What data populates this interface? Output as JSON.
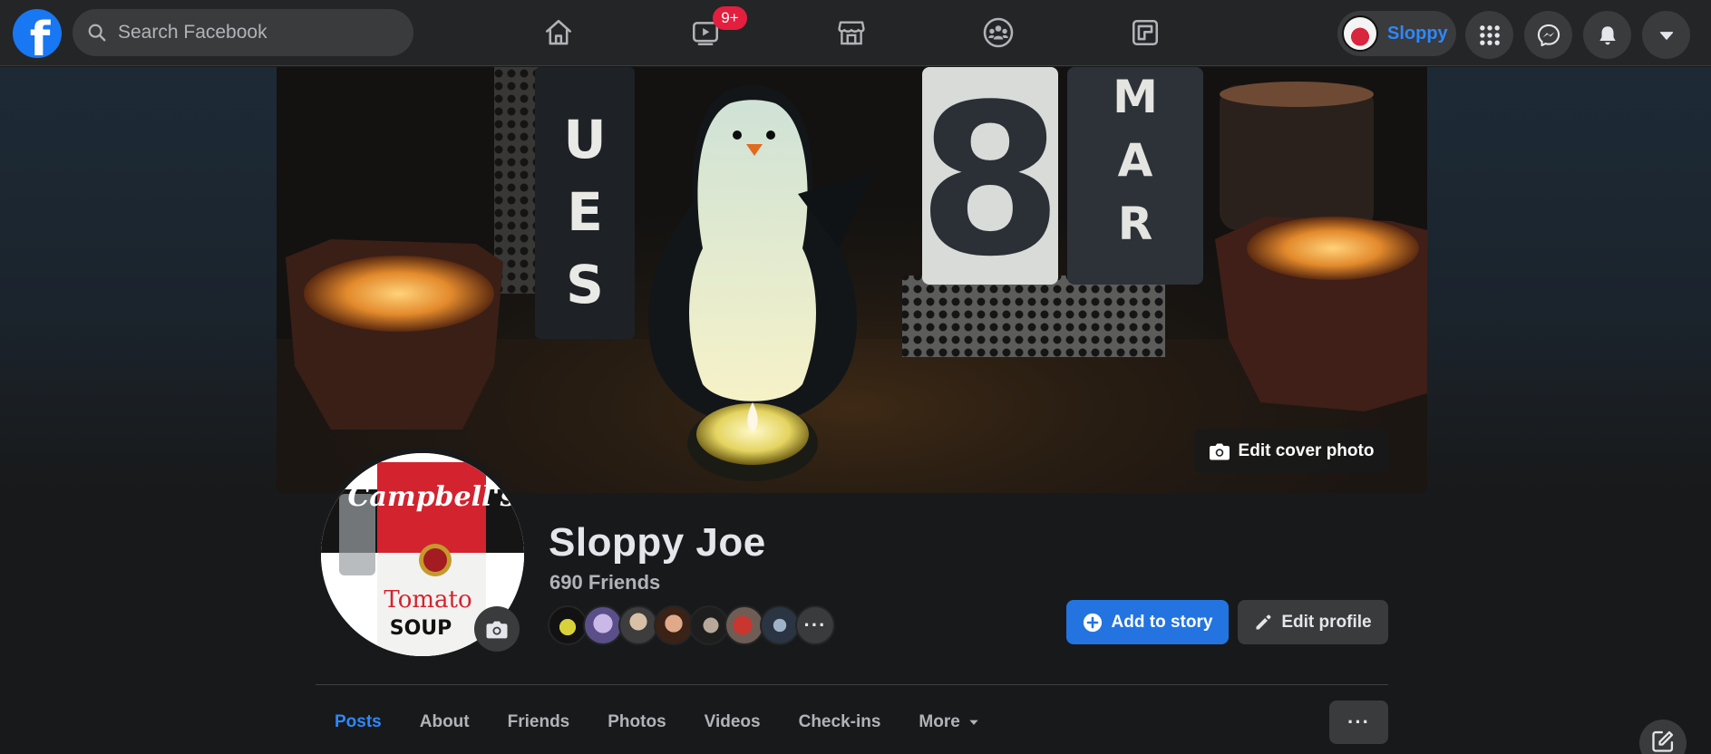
{
  "header": {
    "search_placeholder": "Search Facebook",
    "watch_badge": "9+",
    "profile_chip_name": "Sloppy"
  },
  "profile": {
    "name": "Sloppy Joe",
    "friends_label": "690 Friends",
    "friend_more": "···"
  },
  "cover": {
    "edit_cover_label": "Edit cover photo"
  },
  "actions": {
    "add_story_label": "Add to story",
    "edit_profile_label": "Edit profile"
  },
  "tabs": {
    "posts": "Posts",
    "about": "About",
    "friends": "Friends",
    "photos": "Photos",
    "videos": "Videos",
    "checkins": "Check-ins",
    "more": "More",
    "overflow": "···"
  },
  "colors": {
    "background": "#18191a",
    "surface": "#242526",
    "control": "#3a3b3c",
    "accent": "#2d88ff",
    "primary_button": "#2374e1",
    "badge": "#e41e3f",
    "text": "#e4e6eb",
    "muted_text": "#b0b3b8"
  },
  "icons": {
    "logo": "facebook-logo",
    "search": "search-icon",
    "home": "home-icon",
    "watch": "video-icon",
    "marketplace": "store-icon",
    "groups": "groups-icon",
    "gaming": "gaming-icon",
    "menu": "grid-menu-icon",
    "messenger": "messenger-icon",
    "notifications": "bell-icon",
    "account": "caret-down-icon",
    "camera": "camera-icon",
    "plus": "plus-circle-icon",
    "pencil": "pencil-icon",
    "compose": "compose-icon"
  }
}
